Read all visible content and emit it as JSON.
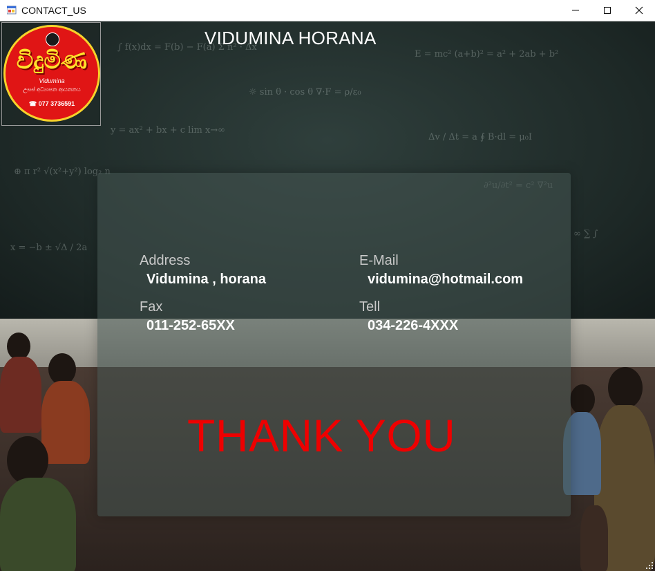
{
  "window": {
    "title": "CONTACT_US",
    "controls": {
      "minimize": "minimize",
      "maximize": "maximize",
      "close": "close"
    }
  },
  "logo": {
    "main_text": "විදුමිණ",
    "sub_text": "Vidumina",
    "tagline": "උසස් අධ්‍යාපන ආයතනය",
    "phone": "077 3736591"
  },
  "header": {
    "title": "VIDUMINA HORANA"
  },
  "contact": {
    "address_label": "Address",
    "address_value": "Vidumina , horana",
    "email_label": "E-Mail",
    "email_value": "vidumina@hotmail.com",
    "fax_label": "Fax",
    "fax_value": "011-252-65XX",
    "tell_label": "Tell",
    "tell_value": "034-226-4XXX"
  },
  "message": {
    "thank_you": "THANK YOU"
  },
  "colors": {
    "accent_red": "#ee0000",
    "logo_red": "#e01515",
    "logo_yellow": "#f7d22b"
  }
}
